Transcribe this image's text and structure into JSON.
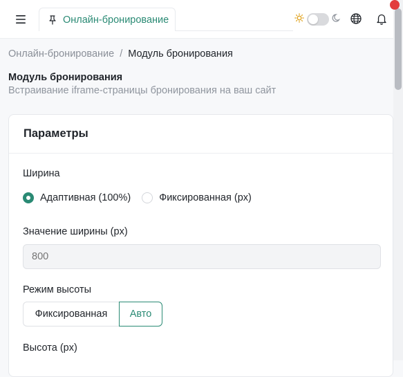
{
  "colors": {
    "accent": "#2a8a74",
    "notification_dot": "#e23c3c"
  },
  "topbar": {
    "menu_icon": "hamburger-menu-icon",
    "tab": {
      "icon": "pin-icon",
      "label": "Онлайн-бронирование"
    },
    "theme_toggle": {
      "light_icon": "sun-icon",
      "dark_icon": "moon-icon",
      "state": "light"
    },
    "language_icon": "globe-icon",
    "notifications_icon": "bell-icon"
  },
  "breadcrumb": {
    "parent": "Онлайн-бронирование",
    "separator": "/",
    "current": "Модуль бронирования"
  },
  "page": {
    "title": "Модуль бронирования",
    "subtitle": "Встраивание iframe-страницы бронирования на ваш сайт"
  },
  "params": {
    "title": "Параметры",
    "width_label": "Ширина",
    "width_options": [
      {
        "label": "Адаптивная (100%)",
        "checked": true
      },
      {
        "label": "Фиксированная (px)",
        "checked": false
      }
    ],
    "width_value_label": "Значение ширины (px)",
    "width_value_placeholder": "800",
    "height_mode_label": "Режим высоты",
    "height_mode_options": [
      {
        "label": "Фиксированная",
        "selected": false
      },
      {
        "label": "Авто",
        "selected": true
      }
    ],
    "height_label": "Высота (px)"
  }
}
